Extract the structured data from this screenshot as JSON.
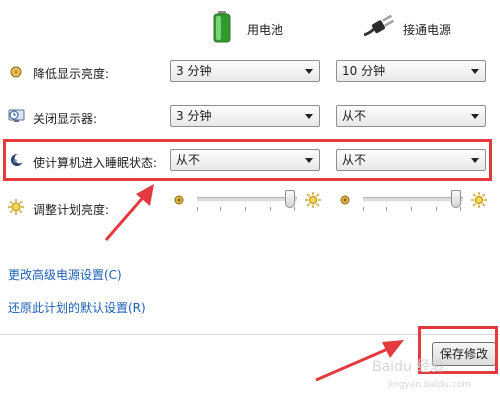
{
  "columns": {
    "battery_label": "用电池",
    "plugged_in_label": "接通电源"
  },
  "rows": [
    {
      "label": "降低显示亮度:",
      "battery": "3 分钟",
      "plugged": "10 分钟"
    },
    {
      "label": "关闭显示器:",
      "battery": "3 分钟",
      "plugged": "从不"
    },
    {
      "label": "使计算机进入睡眠状态:",
      "battery": "从不",
      "plugged": "从不"
    }
  ],
  "brightness": {
    "label": "调整计划亮度:",
    "battery_level": 1.0,
    "plugged_level": 1.0
  },
  "links": {
    "advanced": "更改高级电源设置(C)",
    "restore": "还原此计划的默认设置(R)"
  },
  "buttons": {
    "save": "保存修改"
  },
  "watermark": {
    "brand": "Baidu 经验",
    "url": "jingyan.baidu.com"
  },
  "colors": {
    "annotation_red": "#e23a3f",
    "link_blue": "#1e5fb4"
  }
}
